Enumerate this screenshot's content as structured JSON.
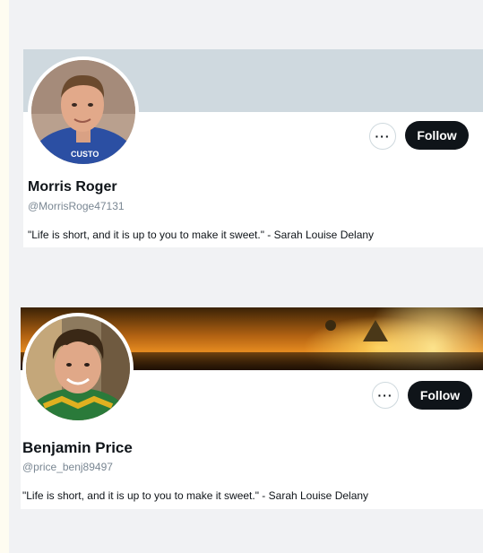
{
  "profiles": [
    {
      "name": "Morris Roger",
      "handle": "@MorrisRoge47131",
      "bio": "\"Life is short, and it is up to you to make it sweet.\" - Sarah Louise Delany",
      "follow_label": "Follow",
      "more_label": "···",
      "shirt_text": "CUSTO"
    },
    {
      "name": "Benjamin Price",
      "handle": "@price_benj89497",
      "bio": "\"Life is short, and it is up to you to make it sweet.\" - Sarah Louise Delany",
      "follow_label": "Follow",
      "more_label": "···"
    }
  ],
  "colors": {
    "follow_bg": "#0f1419",
    "handle": "#7a8793",
    "banner_1": "#cfd9df"
  }
}
